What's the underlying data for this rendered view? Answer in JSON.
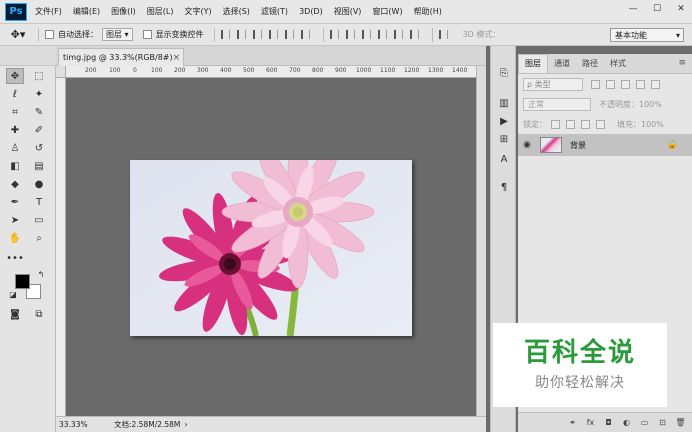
{
  "app": {
    "logo": "Ps"
  },
  "menu": [
    "文件(F)",
    "编辑(E)",
    "图像(I)",
    "图层(L)",
    "文字(Y)",
    "选择(S)",
    "滤镜(T)",
    "3D(D)",
    "视图(V)",
    "窗口(W)",
    "帮助(H)"
  ],
  "options": {
    "auto_select_label": "自动选择：",
    "auto_select_value": "图层",
    "show_transform_label": "显示变换控件",
    "mode_3d_label": "3D 模式：",
    "workspace": "基本功能"
  },
  "document": {
    "tab_title": "timg.jpg @ 33.3%(RGB/8#)",
    "close_glyph": "×",
    "ruler_ticks": [
      "200",
      "100",
      "0",
      "100",
      "200",
      "300",
      "400",
      "500",
      "600",
      "700",
      "800",
      "900",
      "1000",
      "1100",
      "1200",
      "1300",
      "1400"
    ]
  },
  "status": {
    "zoom": "33.33%",
    "doc_info": "文档:2.58M/2.58M",
    "arrow": "›"
  },
  "layers_panel": {
    "tabs": [
      "图层",
      "通道",
      "路径",
      "样式"
    ],
    "filter_label": "ρ 类型",
    "blend_mode": "正常",
    "opacity_label": "不透明度：100%",
    "lock_label": "锁定：",
    "fill_label": "填充：100%",
    "layer_name": "背景"
  },
  "watermark": {
    "title": "百科全说",
    "subtitle": "助你轻松解决"
  },
  "colors": {
    "foreground": "#000000",
    "background": "#ffffff",
    "canvas_bg": "#6a6a6a",
    "watermark_green": "#2a9a3a"
  }
}
